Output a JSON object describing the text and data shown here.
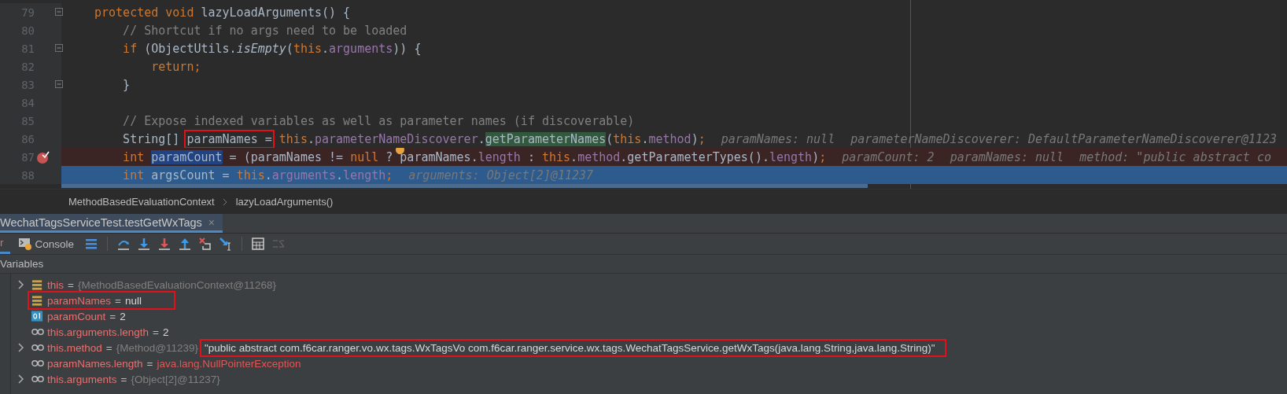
{
  "editor": {
    "lines": [
      {
        "number": "79",
        "fold": true,
        "breakpoint": false,
        "current": false,
        "tokens": [
          {
            "text": "protected void ",
            "kind": "kw"
          },
          {
            "text": "lazyLoadArguments() {",
            "kind": "plain"
          }
        ]
      },
      {
        "number": "80",
        "fold": false,
        "breakpoint": false,
        "current": false,
        "tokens": [
          {
            "text": "    // Shortcut if no args need to be loaded",
            "kind": "comment"
          }
        ]
      },
      {
        "number": "81",
        "fold": true,
        "breakpoint": false,
        "current": false,
        "tokens": [
          {
            "text": "    if ",
            "kind": "kw"
          },
          {
            "text": "(ObjectUtils.",
            "kind": "plain"
          },
          {
            "text": "isEmpty",
            "kind": "static"
          },
          {
            "text": "(",
            "kind": "plain"
          },
          {
            "text": "this",
            "kind": "kw"
          },
          {
            "text": ".",
            "kind": "plain"
          },
          {
            "text": "arguments",
            "kind": "field"
          },
          {
            "text": ")) {",
            "kind": "plain"
          }
        ]
      },
      {
        "number": "82",
        "fold": false,
        "breakpoint": false,
        "current": false,
        "tokens": [
          {
            "text": "        return;",
            "kind": "kw"
          }
        ]
      },
      {
        "number": "83",
        "fold": true,
        "breakpoint": false,
        "current": false,
        "tokens": [
          {
            "text": "    }",
            "kind": "plain"
          }
        ]
      },
      {
        "number": "84",
        "fold": false,
        "breakpoint": false,
        "current": false
      },
      {
        "number": "85",
        "fold": false,
        "breakpoint": false,
        "current": false,
        "tokens": [
          {
            "text": "    // Expose indexed variables as well as parameter names (if discoverable)",
            "kind": "comment"
          }
        ]
      },
      {
        "number": "86",
        "fold": false,
        "breakpoint": false,
        "current": false,
        "tokens": [
          {
            "text": "    String[] ",
            "kind": "plain"
          },
          {
            "text": "paramNames =",
            "kind": "boxed"
          },
          {
            "text": " this",
            "kind": "kw"
          },
          {
            "text": ".",
            "kind": "plain"
          },
          {
            "text": "parameterNameDiscoverer",
            "kind": "field"
          },
          {
            "text": ".",
            "kind": "plain"
          },
          {
            "text": "getParameterNames",
            "kind": "call"
          },
          {
            "text": "(",
            "kind": "plain"
          },
          {
            "text": "this",
            "kind": "kw"
          },
          {
            "text": ".",
            "kind": "plain"
          },
          {
            "text": "method",
            "kind": "field"
          },
          {
            "text": ")",
            "kind": "plain"
          },
          {
            "text": ";",
            "kind": "kw"
          }
        ],
        "hints": [
          "paramNames: null",
          "parameterNameDiscoverer: DefaultParameterNameDiscoverer@1123"
        ]
      },
      {
        "number": "87",
        "fold": false,
        "breakpoint": true,
        "current": false,
        "tokens": [
          {
            "text": "    int ",
            "kind": "kw"
          },
          {
            "text": "paramCount",
            "kind": "selection"
          },
          {
            "text": " = (paramNames != ",
            "kind": "plain"
          },
          {
            "text": "null",
            "kind": "kw"
          },
          {
            "text": " ? ",
            "kind": "plain"
          },
          {
            "text": "paramNames.",
            "kind": "plain",
            "bulb": true
          },
          {
            "text": "length",
            "kind": "field"
          },
          {
            "text": " : ",
            "kind": "plain"
          },
          {
            "text": "this",
            "kind": "kw"
          },
          {
            "text": ".",
            "kind": "plain"
          },
          {
            "text": "method",
            "kind": "field"
          },
          {
            "text": ".getParameterTypes().",
            "kind": "plain"
          },
          {
            "text": "length",
            "kind": "field"
          },
          {
            "text": ")",
            "kind": "plain"
          },
          {
            "text": ";",
            "kind": "kw"
          }
        ],
        "hints": [
          "paramCount: 2",
          "paramNames: null",
          "method: \"public abstract co"
        ]
      },
      {
        "number": "88",
        "fold": false,
        "breakpoint": false,
        "current": true,
        "tokens": [
          {
            "text": "    int ",
            "kind": "kw"
          },
          {
            "text": "argsCount = ",
            "kind": "plain"
          },
          {
            "text": "this",
            "kind": "kw"
          },
          {
            "text": ".",
            "kind": "plain"
          },
          {
            "text": "arguments",
            "kind": "field"
          },
          {
            "text": ".",
            "kind": "plain"
          },
          {
            "text": "length",
            "kind": "field"
          },
          {
            "text": ";",
            "kind": "kw"
          }
        ],
        "hints": [
          "arguments: Object[2]@11237"
        ]
      }
    ]
  },
  "breadcrumb": [
    "MethodBasedEvaluationContext",
    "lazyLoadArguments()"
  ],
  "session_tab": {
    "label": "WechatTagsServiceTest.testGetWxTags",
    "close": "×"
  },
  "debug_tabs": [
    {
      "label": "r",
      "selected": true
    },
    {
      "label": "Console",
      "selected": false
    }
  ],
  "toolbar": [
    {
      "kind": "frames",
      "disabled": false
    },
    {
      "kind": "step-over",
      "disabled": false
    },
    {
      "kind": "step-into",
      "disabled": false
    },
    {
      "kind": "force-step-into",
      "disabled": false
    },
    {
      "kind": "step-out",
      "disabled": false
    },
    {
      "kind": "drop-frame",
      "disabled": false
    },
    {
      "kind": "run-to-cursor",
      "disabled": false
    },
    {
      "kind": "evaluate",
      "disabled": false
    },
    {
      "kind": "trace",
      "disabled": true
    }
  ],
  "variables": {
    "title": "Variables",
    "rows": [
      {
        "kind": "field",
        "expandable": true,
        "name": "this",
        "op": "=",
        "ref": "{MethodBasedEvaluationContext@11268}",
        "row_boxed": false
      },
      {
        "kind": "field",
        "expandable": false,
        "name": "paramNames",
        "op": "=",
        "value": "null",
        "error": false,
        "row_boxed": true,
        "value_boxed": false
      },
      {
        "kind": "primitive",
        "expandable": false,
        "name": "paramCount",
        "op": "=",
        "value": "2",
        "error": false,
        "row_boxed": false,
        "value_boxed": false
      },
      {
        "kind": "watch",
        "expandable": false,
        "name": "this.arguments.length",
        "op": "=",
        "value": "2",
        "error": false,
        "row_boxed": false,
        "value_boxed": false
      },
      {
        "kind": "watch",
        "expandable": true,
        "name": "this.method",
        "op": "=",
        "ref": "{Method@11239}",
        "value": "\"public abstract com.f6car.ranger.vo.wx.tags.WxTagsVo com.f6car.ranger.service.wx.tags.WechatTagsService.getWxTags(java.lang.String,java.lang.String)\"",
        "error": false,
        "row_boxed": false,
        "value_boxed": true
      },
      {
        "kind": "watch",
        "expandable": false,
        "name": "paramNames.length",
        "op": "=",
        "value": "java.lang.NullPointerException",
        "error": true,
        "row_boxed": false,
        "value_boxed": false
      },
      {
        "kind": "watch",
        "expandable": true,
        "name": "this.arguments",
        "op": "=",
        "ref": "{Object[2]@11237}",
        "row_boxed": false
      }
    ]
  }
}
